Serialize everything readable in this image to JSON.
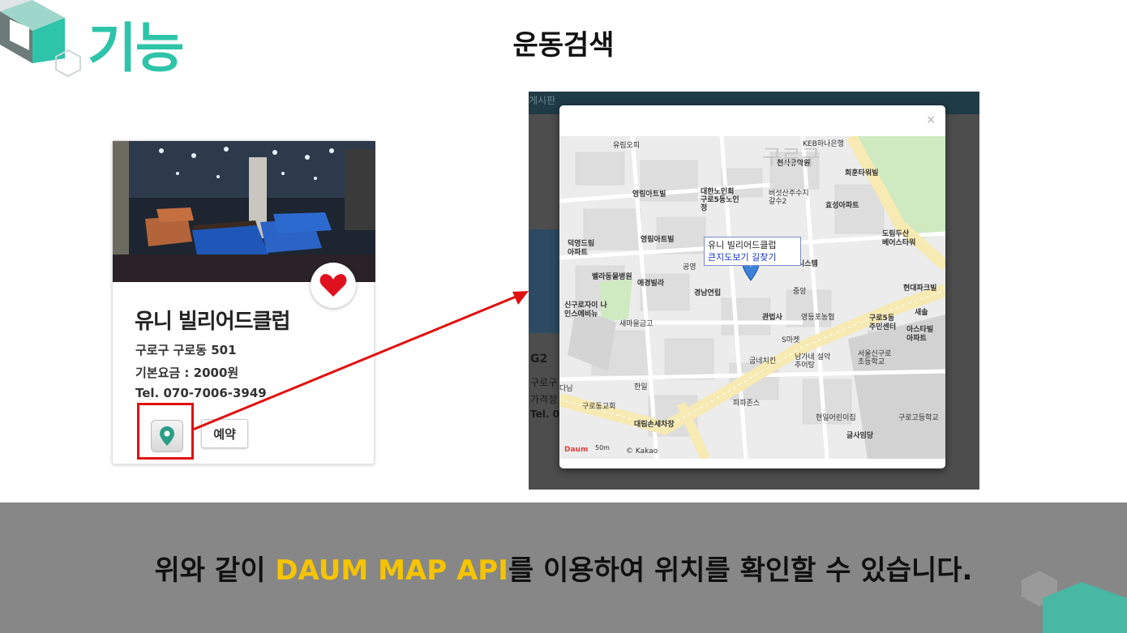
{
  "header": {
    "title": "기능",
    "page_title": "운동검색"
  },
  "card": {
    "name": "유니 빌리어드클럽",
    "address": "구로구 구로동 501",
    "fee": "기본요금 : 2000원",
    "tel": "Tel. 070-7006-3949",
    "reserve_label": "예약",
    "icons": {
      "favorite": "heart-icon",
      "map": "map-pin-icon"
    },
    "colors": {
      "heart": "#e0101e",
      "pin": "#2a9d86",
      "highlight": "#e01010"
    }
  },
  "screenshot": {
    "top_bar_text": "게시판",
    "bg_heading": "G2",
    "bg_lines": [
      "구로구",
      "가격정",
      "Tel. 07"
    ],
    "modal": {
      "close": "×",
      "info_window": {
        "title": "유니 빌리어드클럽",
        "links": "큰지도보기 길찾기"
      },
      "map_labels": [
        "유림오피",
        "KEB하나은행",
        "천사유악원",
        "회훈타워빌",
        "영림아트빌",
        "대한노인회 구로5동노인정",
        "버섯산주수지 갈수2",
        "효성아파트",
        "영림아트빌",
        "덕영드림 아파트",
        "도림두산 베어스타워",
        "공영",
        "벨라동물병원",
        "애경빌라",
        "경남연립",
        "중앙",
        "현대파크빌",
        "신구로자이 나인스에비뉴",
        "새마을금고",
        "관법사",
        "영등포농협",
        "구로5동 주민센터",
        "새솔",
        "아스타빌 아파트",
        "S마켓",
        "굽네치킨",
        "남가네 설악추어탕",
        "서울신구로 초등학교",
        "다님",
        "한일",
        "구로동교회",
        "파파존스",
        "현일어린이집",
        "구로고등학교",
        "대림손세차장",
        "글사임당",
        "시스템",
        "구로구"
      ],
      "logo": "Daum",
      "scale": "50m",
      "copyright": "© Kakao"
    }
  },
  "footer": {
    "text_before": "위와 같이 ",
    "highlight": "DAUM MAP API",
    "text_after": "를 이용하여 위치를 확인할 수 있습니다.",
    "highlight_color": "#f5c400"
  }
}
